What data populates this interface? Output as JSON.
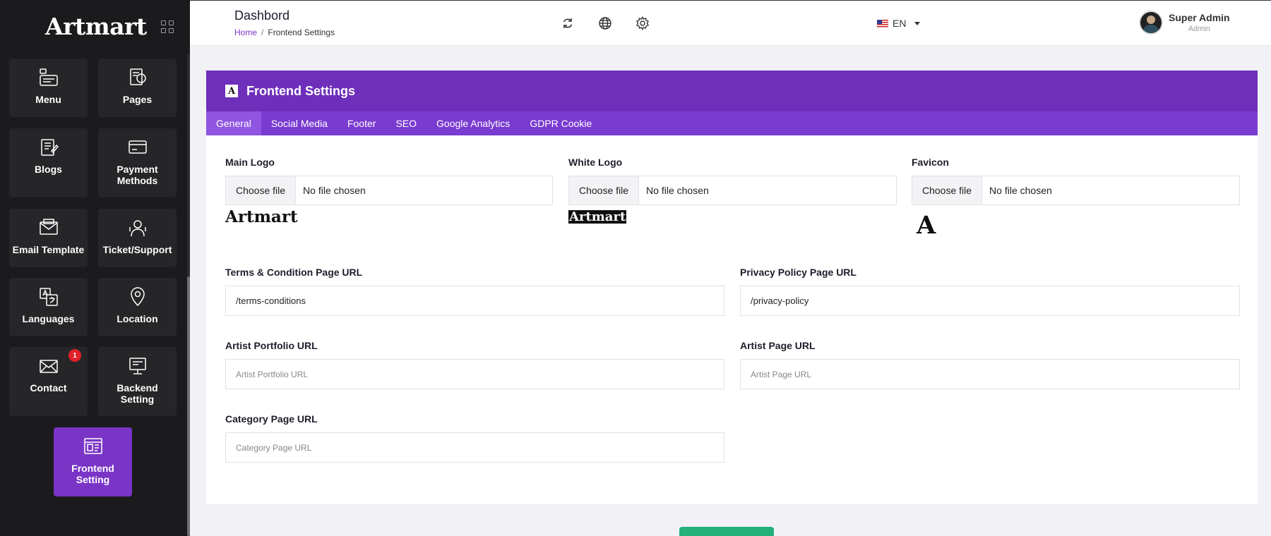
{
  "sidebar": {
    "brand": "Artmart",
    "items": [
      {
        "label": "Menu",
        "icon": "menu-icon"
      },
      {
        "label": "Pages",
        "icon": "pages-icon"
      },
      {
        "label": "Blogs",
        "icon": "blogs-icon"
      },
      {
        "label": "Payment Methods",
        "icon": "payment-card-icon"
      },
      {
        "label": "Email Template",
        "icon": "email-template-icon"
      },
      {
        "label": "Ticket/Support",
        "icon": "support-icon"
      },
      {
        "label": "Languages",
        "icon": "languages-icon"
      },
      {
        "label": "Location",
        "icon": "location-pin-icon"
      },
      {
        "label": "Contact",
        "icon": "envelope-icon",
        "badge": "1"
      },
      {
        "label": "Backend Setting",
        "icon": "backend-setting-icon"
      },
      {
        "label": "Frontend Setting",
        "icon": "frontend-setting-icon",
        "active": true
      }
    ]
  },
  "topbar": {
    "title": "Dashbord",
    "breadcrumb": {
      "home": "Home",
      "separator": "/",
      "current": "Frontend Settings"
    },
    "icons": [
      "refresh-icon",
      "globe-icon",
      "gear-icon"
    ],
    "language": "EN",
    "user": {
      "name": "Super Admin",
      "role": "Admin"
    }
  },
  "card": {
    "title": "Frontend Settings",
    "tabs": [
      "General",
      "Social Media",
      "Footer",
      "SEO",
      "Google Analytics",
      "GDPR Cookie"
    ],
    "active_tab": "General",
    "logos": [
      {
        "label": "Main Logo",
        "button": "Choose file",
        "status": "No file chosen",
        "preview": "Artmart"
      },
      {
        "label": "White Logo",
        "button": "Choose file",
        "status": "No file chosen",
        "preview": "Artmart"
      },
      {
        "label": "Favicon",
        "button": "Choose file",
        "status": "No file chosen",
        "preview": "A"
      }
    ],
    "fields": {
      "terms": {
        "label": "Terms & Condition Page URL",
        "value": "/terms-conditions"
      },
      "privacy": {
        "label": "Privacy Policy Page URL",
        "value": "/privacy-policy"
      },
      "portfolio": {
        "label": "Artist Portfolio URL",
        "placeholder": "Artist Portfolio URL"
      },
      "artist_page": {
        "label": "Artist Page URL",
        "placeholder": "Artist Page URL"
      },
      "category": {
        "label": "Category Page URL",
        "placeholder": "Category Page URL"
      }
    }
  },
  "colors": {
    "accent": "#7a35c6",
    "header": "#6e2fbb",
    "sidebar": "#1b1b1d",
    "save": "#23b07a"
  }
}
